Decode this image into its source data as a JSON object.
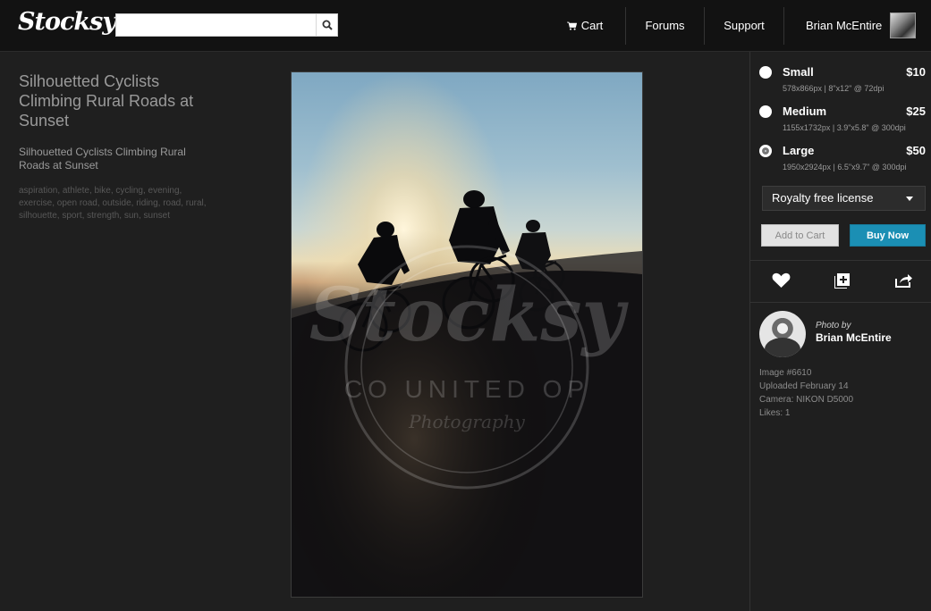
{
  "header": {
    "logo": "Stocksy",
    "search": {
      "value": "",
      "placeholder": ""
    },
    "nav": {
      "cart": "Cart",
      "forums": "Forums",
      "support": "Support",
      "user": "Brian McEntire"
    }
  },
  "image": {
    "title": "Silhouetted Cyclists Climbing Rural Roads at Sunset",
    "description": "Silhouetted Cyclists Climbing Rural Roads at Sunset",
    "tags": "aspiration, athlete, bike, cycling, evening, exercise, open road, outside, riding, road, rural, silhouette, sport, strength, sun, sunset",
    "watermark": {
      "brand": "Stocksy",
      "ring_text": "CO UNITED OP",
      "sub": "Photography"
    }
  },
  "purchase": {
    "sizes": [
      {
        "name": "Small",
        "price": "$10",
        "spec": "578x866px  |  8\"x12\" @ 72dpi",
        "selected": false
      },
      {
        "name": "Medium",
        "price": "$25",
        "spec": "1155x1732px  |  3.9\"x5.8\" @ 300dpi",
        "selected": false
      },
      {
        "name": "Large",
        "price": "$50",
        "spec": "1950x2924px  |  6.5\"x9.7\" @ 300dpi",
        "selected": true
      }
    ],
    "license": "Royalty free license",
    "add_to_cart": "Add to Cart",
    "buy_now": "Buy Now"
  },
  "actions": [
    "heart-icon",
    "add-to-collection-icon",
    "share-icon"
  ],
  "photographer": {
    "label": "Photo by",
    "name": "Brian McEntire",
    "image_id": "Image #6610",
    "uploaded": "Uploaded February 14",
    "camera": "Camera: NIKON D5000",
    "likes": "Likes: 1"
  },
  "colors": {
    "background": "#1f1f1f",
    "header": "#121212",
    "buy_button": "#1b8fb4"
  }
}
